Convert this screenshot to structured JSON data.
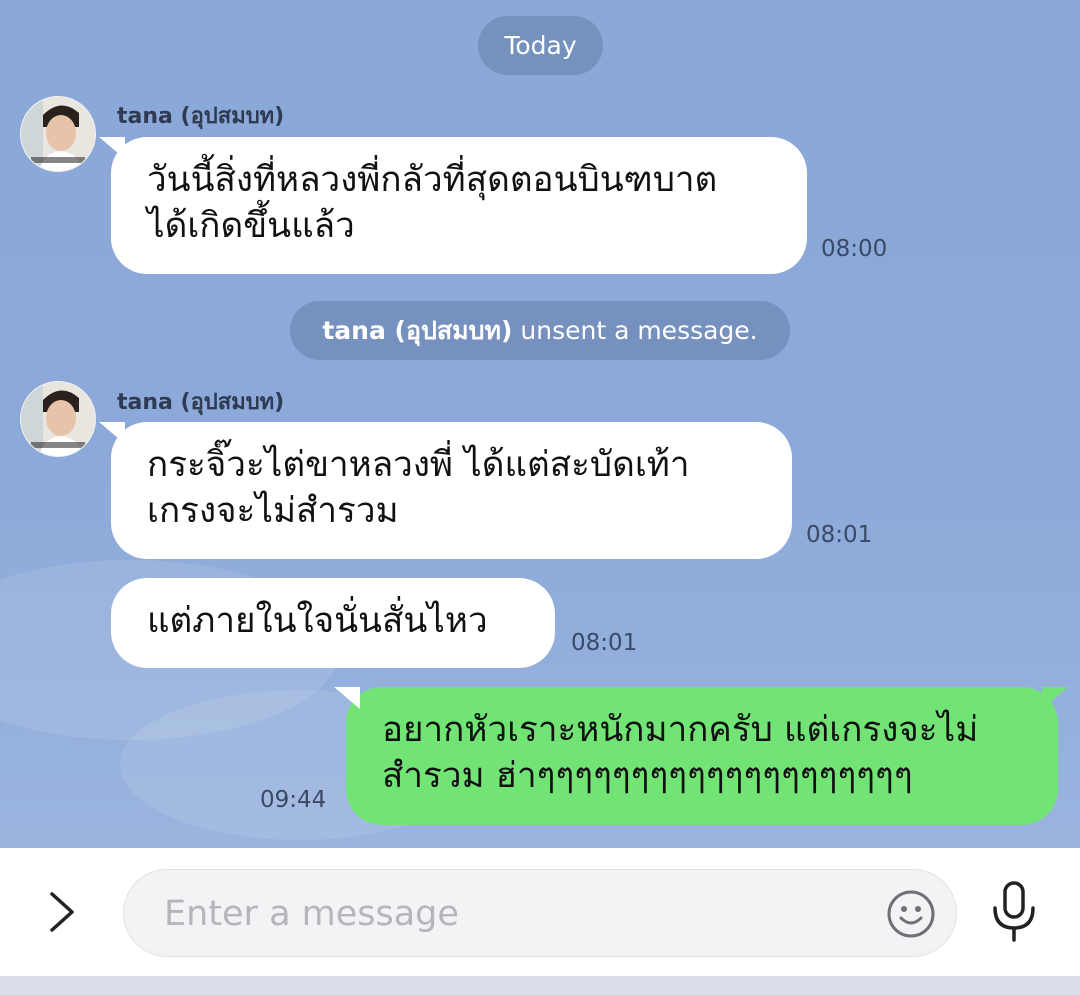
{
  "chat": {
    "date_label": "Today",
    "system_notice": {
      "name": "tana (อุปสมบท)",
      "text": "unsent a message."
    },
    "messages": [
      {
        "sender": "tana (อุปสมบท)",
        "line1": "วันนี้สิ่งที่หลวงพี่กลัวที่สุดตอนบินฑบาต",
        "line2": "ได้เกิดขึ้นแล้ว",
        "time": "08:00"
      },
      {
        "sender": "tana (อุปสมบท)",
        "line1": "กระจิ๊วะไต่ขาหลวงพี่  ได้แต่สะบัดเท้า",
        "line2": "เกรงจะไม่สำรวม",
        "time": "08:01"
      },
      {
        "text": "แต่ภายในใจนั่นสั่นไหว",
        "time": "08:01"
      },
      {
        "line1": "อยากหัวเราะหนักมากครับ แต่เกรงจะไม่",
        "line2": "สำรวม ฮ่าๆๆๆๆๆๆๆๆๆๆๆๆๆๆๆๆๆๆๆๆ",
        "time": "09:44"
      }
    ]
  },
  "composer": {
    "placeholder": "Enter a message",
    "expand_icon": "chevron-right-icon",
    "emoji_icon": "smiley-icon",
    "mic_icon": "microphone-icon"
  },
  "colors": {
    "chat_background": "#8aa8d8",
    "incoming_bubble": "#ffffff",
    "outgoing_bubble": "#72e476",
    "pill_background": "#6b86b9"
  }
}
